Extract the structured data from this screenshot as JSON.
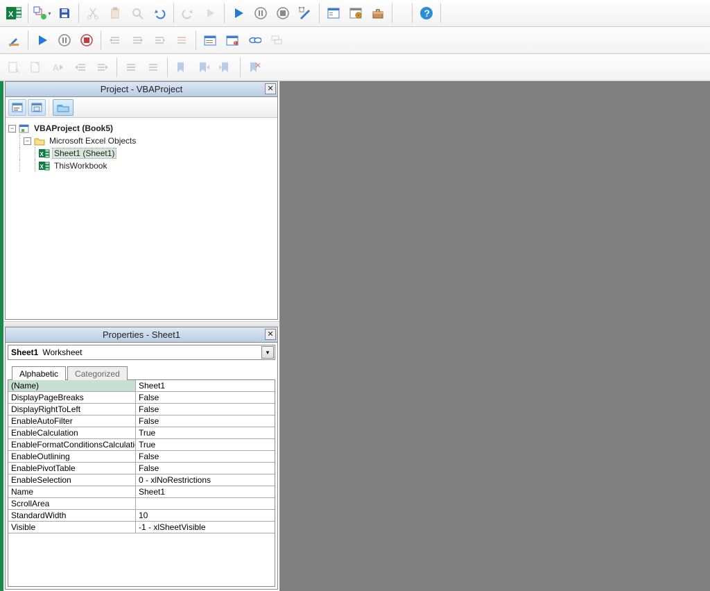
{
  "panels": {
    "project": {
      "title": "Project - VBAProject"
    },
    "properties": {
      "title": "Properties - Sheet1"
    }
  },
  "tree": {
    "root": "VBAProject (Book5)",
    "folder": "Microsoft Excel Objects",
    "items": [
      "Sheet1 (Sheet1)",
      "ThisWorkbook"
    ]
  },
  "object_selector": {
    "name": "Sheet1",
    "type": "Worksheet"
  },
  "tabs": {
    "alphabetic": "Alphabetic",
    "categorized": "Categorized"
  },
  "properties": [
    {
      "k": "(Name)",
      "v": "Sheet1",
      "sel": true
    },
    {
      "k": "DisplayPageBreaks",
      "v": "False"
    },
    {
      "k": "DisplayRightToLeft",
      "v": "False"
    },
    {
      "k": "EnableAutoFilter",
      "v": "False"
    },
    {
      "k": "EnableCalculation",
      "v": "True"
    },
    {
      "k": "EnableFormatConditionsCalculation",
      "v": "True"
    },
    {
      "k": "EnableOutlining",
      "v": "False"
    },
    {
      "k": "EnablePivotTable",
      "v": "False"
    },
    {
      "k": "EnableSelection",
      "v": "0 - xlNoRestrictions"
    },
    {
      "k": "Name",
      "v": "Sheet1"
    },
    {
      "k": "ScrollArea",
      "v": ""
    },
    {
      "k": "StandardWidth",
      "v": "10"
    },
    {
      "k": "Visible",
      "v": "-1 - xlSheetVisible"
    }
  ]
}
